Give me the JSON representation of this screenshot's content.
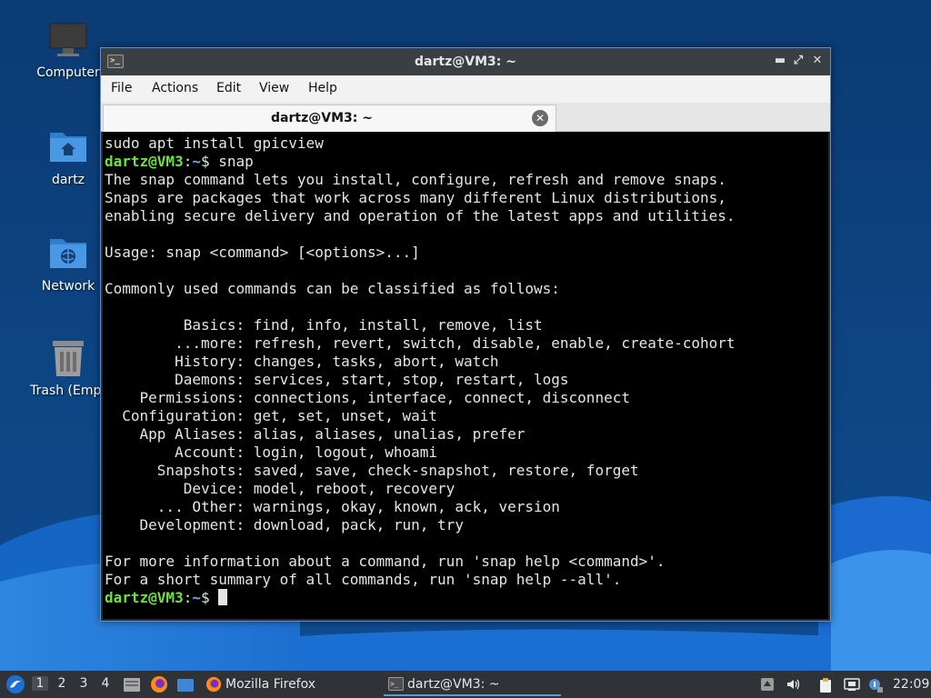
{
  "desktop": {
    "icons": [
      {
        "label": "Computer",
        "icon": "monitor-icon"
      },
      {
        "label": "dartz",
        "icon": "home-folder-icon"
      },
      {
        "label": "Network",
        "icon": "network-folder-icon"
      },
      {
        "label": "Trash (Empt",
        "icon": "trash-icon"
      }
    ]
  },
  "window": {
    "title": "dartz@VM3: ~",
    "menu": [
      "File",
      "Actions",
      "Edit",
      "View",
      "Help"
    ],
    "tab_label": "dartz@VM3: ~",
    "controls": {
      "minimize": "minimize-icon",
      "maximize": "maximize-icon",
      "close": "close-icon"
    }
  },
  "terminal": {
    "prompt_user": "dartz@VM3",
    "prompt_sep": ":",
    "prompt_path": "~",
    "prompt_dollar": "$",
    "command": " snap",
    "lines_before": [
      "sudo apt install gpicview"
    ],
    "output": [
      "The snap command lets you install, configure, refresh and remove snaps.",
      "Snaps are packages that work across many different Linux distributions,",
      "enabling secure delivery and operation of the latest apps and utilities.",
      "",
      "Usage: snap <command> [<options>...]",
      "",
      "Commonly used commands can be classified as follows:",
      "",
      "         Basics: find, info, install, remove, list",
      "        ...more: refresh, revert, switch, disable, enable, create-cohort",
      "        History: changes, tasks, abort, watch",
      "        Daemons: services, start, stop, restart, logs",
      "    Permissions: connections, interface, connect, disconnect",
      "  Configuration: get, set, unset, wait",
      "    App Aliases: alias, aliases, unalias, prefer",
      "        Account: login, logout, whoami",
      "      Snapshots: saved, save, check-snapshot, restore, forget",
      "         Device: model, reboot, recovery",
      "      ... Other: warnings, okay, known, ack, version",
      "    Development: download, pack, run, try",
      "",
      "For more information about a command, run 'snap help <command>'.",
      "For a short summary of all commands, run 'snap help --all'."
    ]
  },
  "taskbar": {
    "workspaces": [
      "1",
      "2",
      "3",
      "4"
    ],
    "active_workspace": "1",
    "tasks": [
      {
        "label": "Mozilla Firefox",
        "icon": "firefox-icon"
      },
      {
        "label": "dartz@VM3: ~",
        "icon": "terminal-icon"
      }
    ],
    "clock": "22:09"
  },
  "colors": {
    "prompt_user": "#6ee23b",
    "prompt_path": "#7ea6ea",
    "window_border": "#5f8fd3",
    "desktop_blue": "#0b3f7a"
  }
}
